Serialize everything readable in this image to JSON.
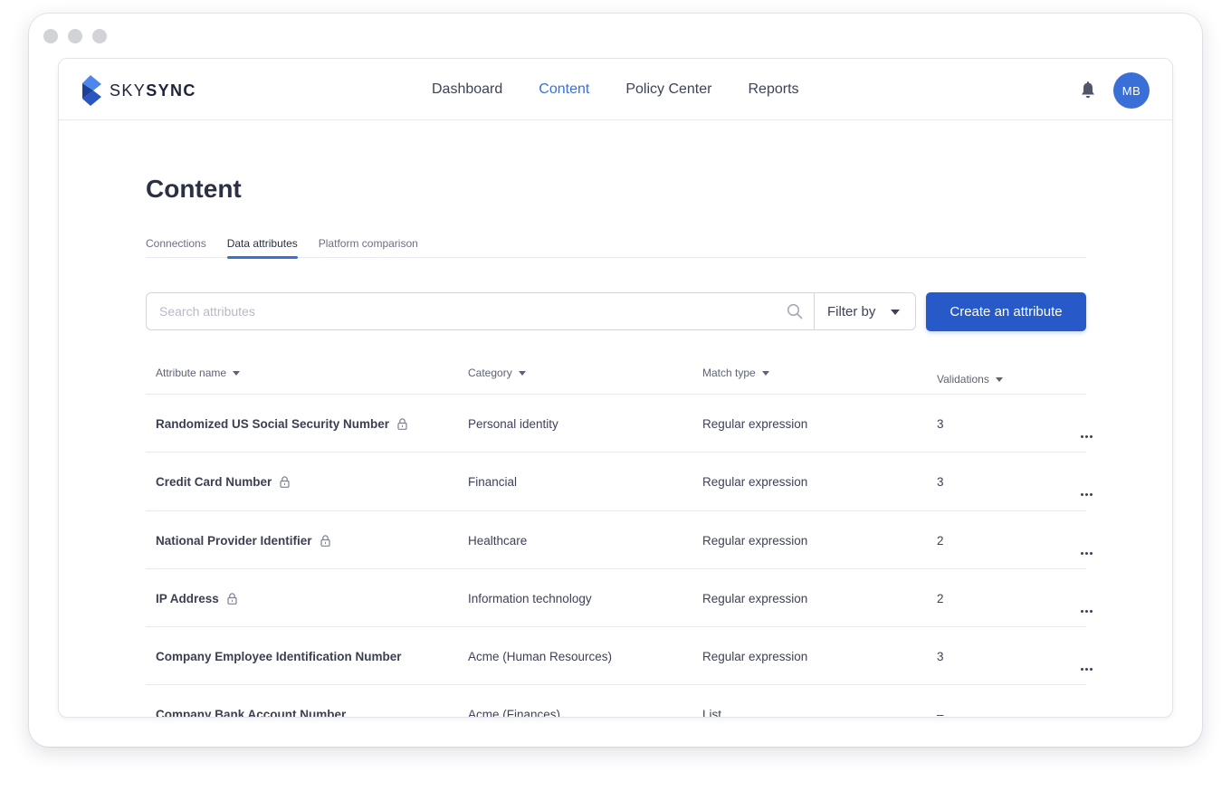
{
  "app": {
    "brand_light": "SKY",
    "brand_bold": "SYNC",
    "avatar_initials": "MB"
  },
  "nav": {
    "items": [
      {
        "label": "Dashboard",
        "active": false
      },
      {
        "label": "Content",
        "active": true
      },
      {
        "label": "Policy Center",
        "active": false
      },
      {
        "label": "Reports",
        "active": false
      }
    ]
  },
  "page": {
    "title": "Content"
  },
  "tabs": [
    {
      "label": "Connections",
      "active": false
    },
    {
      "label": "Data attributes",
      "active": true
    },
    {
      "label": "Platform comparison",
      "active": false
    }
  ],
  "toolbar": {
    "search_placeholder": "Search attributes",
    "filter_label": "Filter by",
    "create_label": "Create an attribute"
  },
  "table": {
    "columns": [
      {
        "label": "Attribute name"
      },
      {
        "label": "Category"
      },
      {
        "label": "Match type"
      },
      {
        "label": "Validations"
      }
    ],
    "rows": [
      {
        "name": "Randomized US Social Security Number",
        "locked": true,
        "category": "Personal identity",
        "match_type": "Regular expression",
        "validations": "3"
      },
      {
        "name": "Credit Card Number",
        "locked": true,
        "category": "Financial",
        "match_type": "Regular expression",
        "validations": "3"
      },
      {
        "name": "National Provider Identifier",
        "locked": true,
        "category": "Healthcare",
        "match_type": "Regular expression",
        "validations": "2"
      },
      {
        "name": "IP Address",
        "locked": true,
        "category": "Information technology",
        "match_type": "Regular expression",
        "validations": "2"
      },
      {
        "name": "Company Employee Identification Number",
        "locked": false,
        "category": "Acme (Human Resources)",
        "match_type": "Regular expression",
        "validations": "3"
      },
      {
        "name": "Company Bank Account Number",
        "locked": false,
        "category": "Acme (Finances)",
        "match_type": "List",
        "validations": "–"
      }
    ]
  },
  "colors": {
    "accent": "#3a6fd8",
    "primary_button": "#2759c9"
  }
}
